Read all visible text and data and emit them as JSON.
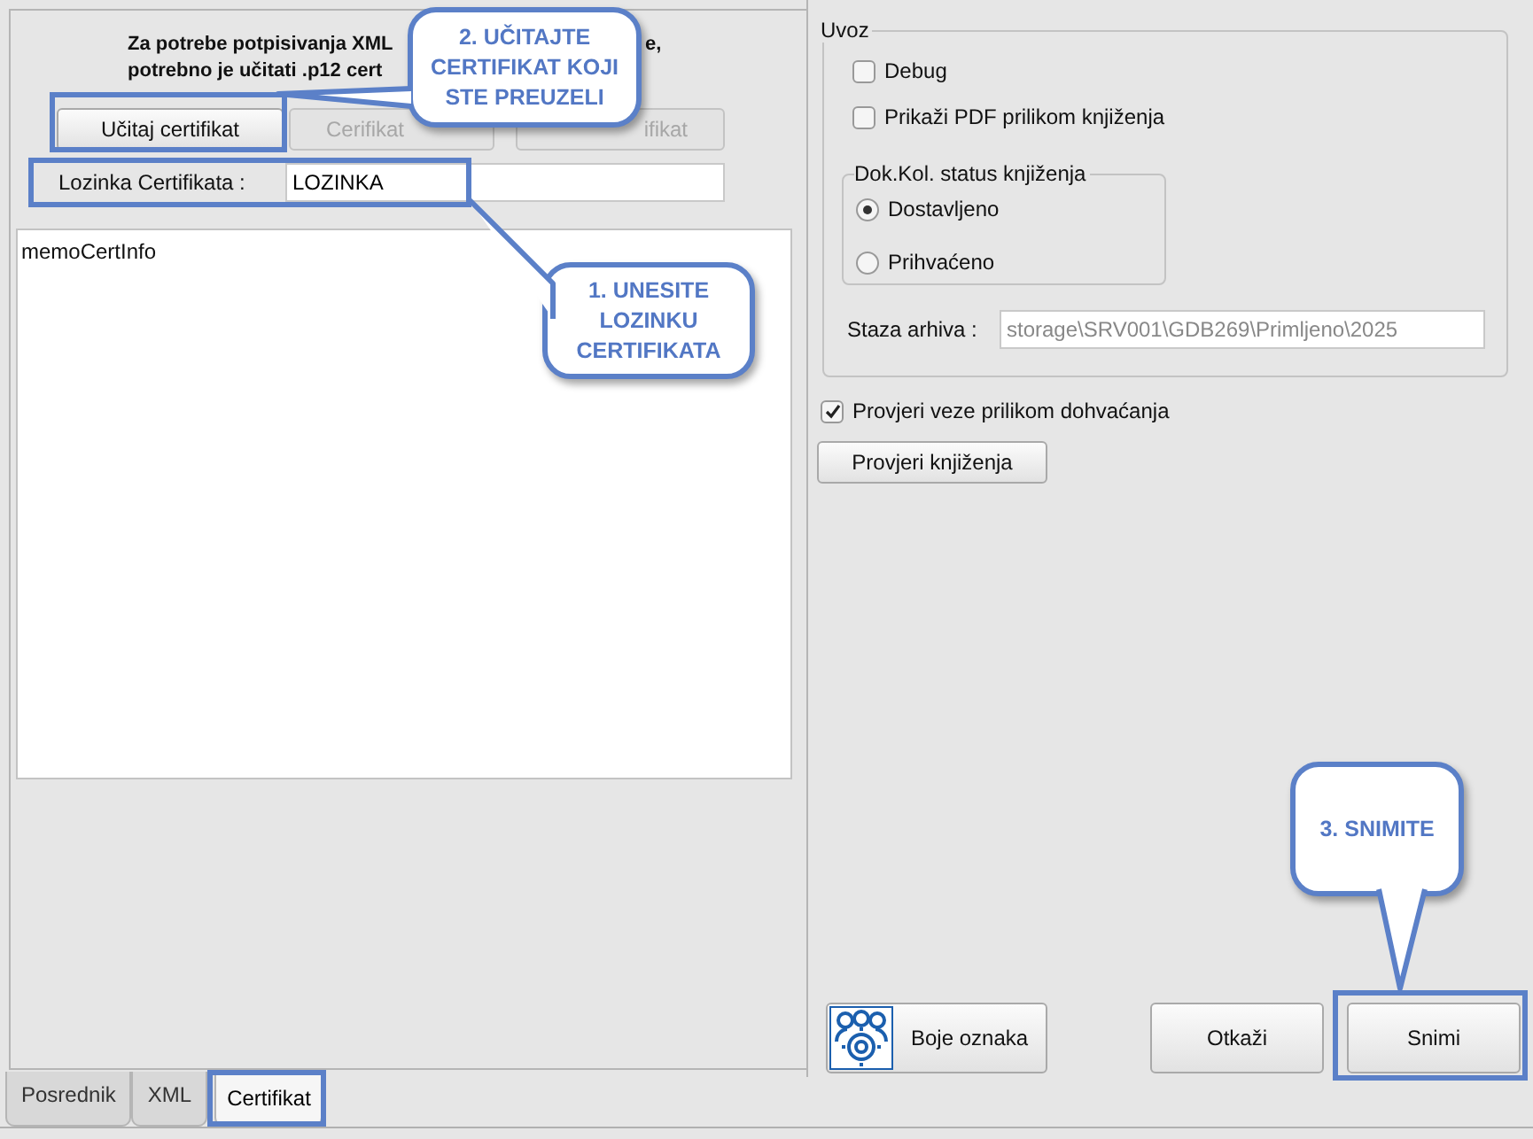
{
  "certificate_panel": {
    "intro_lines": [
      "Za potrebe potpisivanja XML",
      "e,",
      "potrebno je učitati .p12 cert"
    ],
    "buttons": [
      {
        "label": "Učitaj certifikat",
        "disabled": false
      },
      {
        "label": "Cerifikat",
        "disabled": true
      },
      {
        "label": "ifikat",
        "disabled": true
      }
    ],
    "password": {
      "label": "Lozinka Certifikata :",
      "value": "LOZINKA"
    },
    "memo": {
      "value": "memoCertInfo"
    }
  },
  "tabs": [
    {
      "label": "Posrednik",
      "selected": false
    },
    {
      "label": "XML",
      "selected": false
    },
    {
      "label": "Certifikat",
      "selected": true
    }
  ],
  "import_group": {
    "title": "Uvoz",
    "checkboxes": [
      {
        "label": "Debug",
        "checked": false
      },
      {
        "label": "Prikaži PDF prilikom knjiženja",
        "checked": false
      }
    ],
    "status_group": {
      "title": "Dok.Kol. status knjiženja",
      "options": [
        {
          "label": "Dostavljeno",
          "selected": true
        },
        {
          "label": "Prihvaćeno",
          "selected": false
        }
      ]
    },
    "archive_path": {
      "label": "Staza arhiva :",
      "value": "storage\\SRV001\\GDB269\\Primljeno\\2025",
      "disabled": true
    }
  },
  "check_links": {
    "label": "Provjeri veze prilikom dohvaćanja",
    "checked": true
  },
  "check_button": "Provjeri knjiženja",
  "footer_buttons": [
    {
      "kind": "icon",
      "label": "Boje oznaka"
    },
    {
      "kind": "plain",
      "label": "Otkaži"
    },
    {
      "kind": "plain",
      "label": "Snimi"
    }
  ],
  "annotations": [
    "2. UČITAJTE CERTIFIKAT KOJI STE PREUZELI",
    "1. UNESITE LOZINKU CERTIFIKATA",
    "3. SNIMITE"
  ]
}
